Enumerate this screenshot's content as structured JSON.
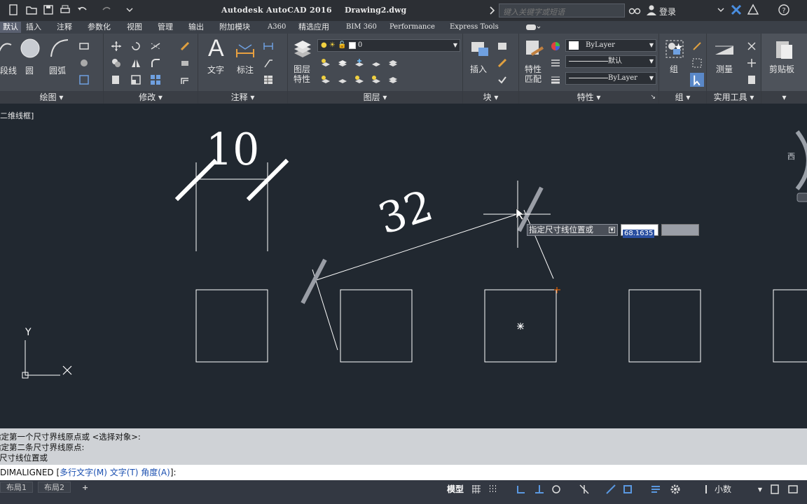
{
  "titlebar": {
    "app_title": "Autodesk AutoCAD 2016",
    "doc_title": "Drawing2.dwg",
    "search_placeholder": "键入关键字或短语",
    "login": "登录"
  },
  "tabs": [
    {
      "label": "默认",
      "active": true
    },
    {
      "label": "插入"
    },
    {
      "label": "注释"
    },
    {
      "label": "参数化"
    },
    {
      "label": "视图"
    },
    {
      "label": "管理"
    },
    {
      "label": "输出"
    },
    {
      "label": "附加模块"
    },
    {
      "label": "A360"
    },
    {
      "label": "精选应用"
    },
    {
      "label": "BIM 360"
    },
    {
      "label": "Performance"
    },
    {
      "label": "Express Tools"
    }
  ],
  "ribbon": {
    "draw": {
      "title": "绘图",
      "polyline": "段线",
      "circle": "圆",
      "arc": "圆弧"
    },
    "modify": {
      "title": "修改"
    },
    "annotation": {
      "title": "注释",
      "text": "文字",
      "dimension": "标注"
    },
    "layers": {
      "title": "图层",
      "layer_props_1": "图层",
      "layer_props_2": "特性",
      "current_layer": "0"
    },
    "block": {
      "title": "块",
      "insert": "插入"
    },
    "properties": {
      "title": "特性",
      "match_1": "特性",
      "match_2": "匹配",
      "color": "ByLayer",
      "linetype": "默认",
      "lineweight": "ByLayer"
    },
    "groups": {
      "title": "组",
      "group": "组"
    },
    "utilities": {
      "title": "实用工具",
      "measure": "测量"
    },
    "clipboard": {
      "paste": "剪贴板"
    }
  },
  "canvas": {
    "viewport_label": "二维线框]",
    "dim_horizontal": "10",
    "dim_aligned": "32",
    "compass_west": "西",
    "ucs_y": "Y",
    "dyn_prompt": "指定尺寸线位置或",
    "dyn_value": "68.1635"
  },
  "command": {
    "history": [
      "指定第一个尺寸界线原点或 <选择对象>:",
      "指定第二条尺寸界线原点:",
      "指定尺寸线位置或"
    ],
    "prefix": "DIMALIGNED [",
    "opt1": "多行文字(M)",
    "opt2": "文字(T)",
    "opt3": "角度(A)",
    "suffix": "]:"
  },
  "status": {
    "layout1": "布局1",
    "layout2": "布局2",
    "add": "+",
    "model": "模型",
    "units": "小数"
  },
  "colors": {
    "canvas_bg": "#212830",
    "ribbon_bg": "#454a52",
    "line": "#ffffff",
    "grip": "#9a9ea6",
    "snap": "#ff6a00"
  }
}
